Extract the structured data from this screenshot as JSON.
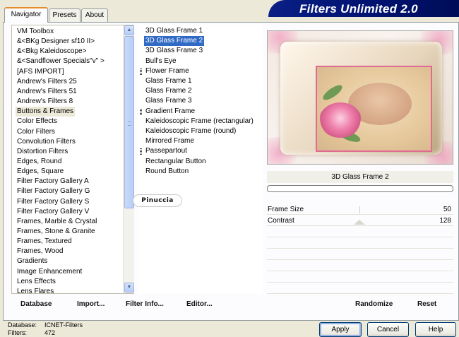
{
  "tabs": [
    {
      "label": "Navigator",
      "active": true
    },
    {
      "label": "Presets",
      "active": false
    },
    {
      "label": "About",
      "active": false
    }
  ],
  "brand": "Filters Unlimited 2.0",
  "categories": [
    "VM Toolbox",
    "&<BKg Designer sf10 II>",
    "&<Bkg Kaleidoscope>",
    "&<Sandflower Specials\"v\" >",
    "[AFS IMPORT]",
    "Andrew's Filters 25",
    "Andrew's Filters 51",
    "Andrew's Filters 8",
    "Buttons & Frames",
    "Color Effects",
    "Color Filters",
    "Convolution Filters",
    "Distortion Filters",
    "Edges, Round",
    "Edges, Square",
    "Filter Factory Gallery A",
    "Filter Factory Gallery G",
    "Filter Factory Gallery S",
    "Filter Factory Gallery V",
    "Frames, Marble & Crystal",
    "Frames, Stone & Granite",
    "Frames, Textured",
    "Frames, Wood",
    "Gradients",
    "Image Enhancement",
    "Lens Effects",
    "Lens Flares"
  ],
  "selected_category": "Buttons & Frames",
  "filters": [
    {
      "label": "3D Glass Frame 1",
      "group": false
    },
    {
      "label": "3D Glass Frame 2",
      "group": false
    },
    {
      "label": "3D Glass Frame 3",
      "group": false
    },
    {
      "label": "Bull's Eye",
      "group": false
    },
    {
      "label": "Flower Frame",
      "group": true
    },
    {
      "label": "Glass Frame 1",
      "group": false
    },
    {
      "label": "Glass Frame 2",
      "group": false
    },
    {
      "label": "Glass Frame 3",
      "group": false
    },
    {
      "label": "Gradient Frame",
      "group": true
    },
    {
      "label": "Kaleidoscopic Frame (rectangular)",
      "group": false
    },
    {
      "label": "Kaleidoscopic Frame (round)",
      "group": false
    },
    {
      "label": "Mirrored Frame",
      "group": false
    },
    {
      "label": "Passepartout",
      "group": true
    },
    {
      "label": "Rectangular Button",
      "group": false
    },
    {
      "label": "Round Button",
      "group": false
    }
  ],
  "selected_filter": "3D Glass Frame 2",
  "watermark": "Pinuccia",
  "preview_name": "3D Glass Frame 2",
  "params": [
    {
      "label": "Frame Size",
      "value": "50"
    },
    {
      "label": "Contrast",
      "value": "128"
    }
  ],
  "bottom_buttons": {
    "database": "Database",
    "import": "Import...",
    "filter_info": "Filter Info...",
    "editor": "Editor...",
    "randomize": "Randomize",
    "reset": "Reset"
  },
  "status": {
    "database_label": "Database:",
    "database_value": "ICNET-Filters",
    "filters_label": "Filters:",
    "filters_value": "472"
  },
  "buttons": {
    "apply": "Apply",
    "cancel": "Cancel",
    "help": "Help"
  },
  "colors": {
    "selection": "#316ac5",
    "brand_bg": "#00126e",
    "tab_active_accent": "#e68b2c",
    "frame_border": "#e06a93"
  }
}
